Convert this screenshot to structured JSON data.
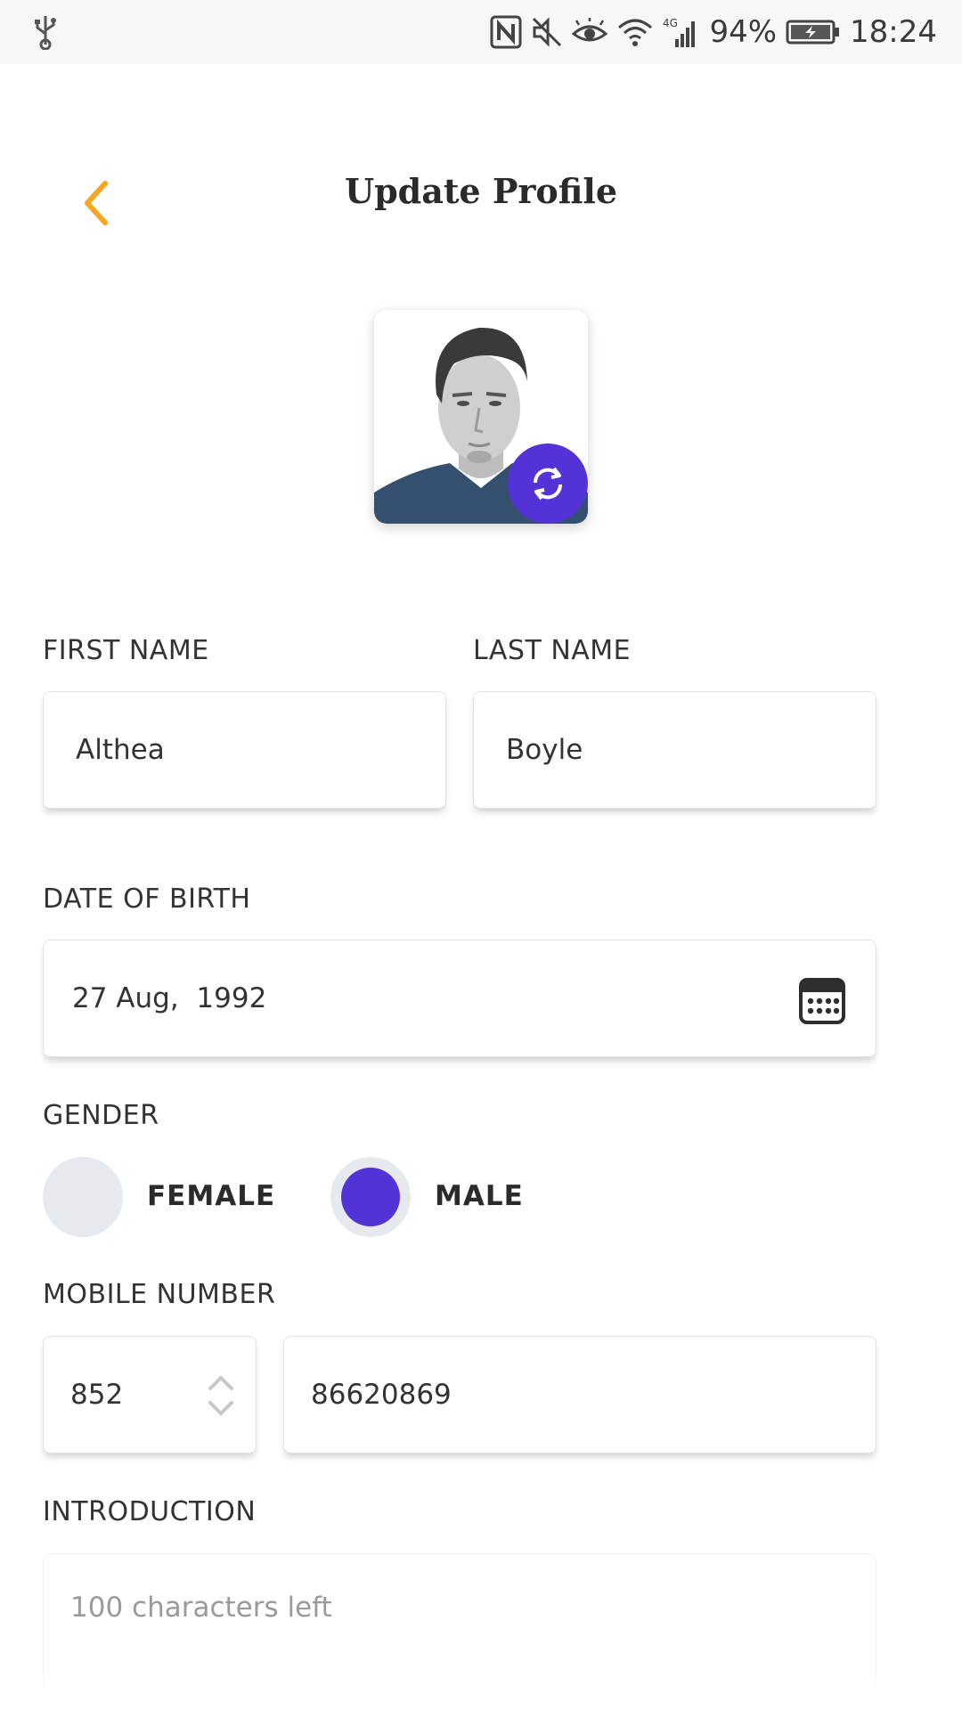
{
  "status_bar": {
    "battery": "94%",
    "time": "18:24",
    "network": "4G",
    "icons": [
      "usb-icon",
      "nfc-icon",
      "mute-icon",
      "eye-comfort-icon",
      "wifi-icon",
      "signal-icon",
      "battery-icon"
    ]
  },
  "header": {
    "title": "Update Profile",
    "back_icon": "chevron-left-icon",
    "accent_color": "#f5a623"
  },
  "avatar": {
    "change_icon": "refresh-icon",
    "button_color": "#5433d6"
  },
  "form": {
    "first_name": {
      "label": "FIRST NAME",
      "value": "Althea"
    },
    "last_name": {
      "label": "LAST NAME",
      "value": "Boyle"
    },
    "dob": {
      "label": "DATE OF BIRTH",
      "value": "27 Aug,  1992",
      "icon": "calendar-icon"
    },
    "gender": {
      "label": "GENDER",
      "options": [
        {
          "label": "FEMALE",
          "selected": false
        },
        {
          "label": "MALE",
          "selected": true
        }
      ]
    },
    "mobile": {
      "label": "MOBILE NUMBER",
      "country_code": "852",
      "number": "86620869",
      "stepper_icon": "up-down-chevron-icon"
    },
    "introduction": {
      "label": "INTRODUCTION",
      "placeholder": "100 characters left"
    }
  }
}
